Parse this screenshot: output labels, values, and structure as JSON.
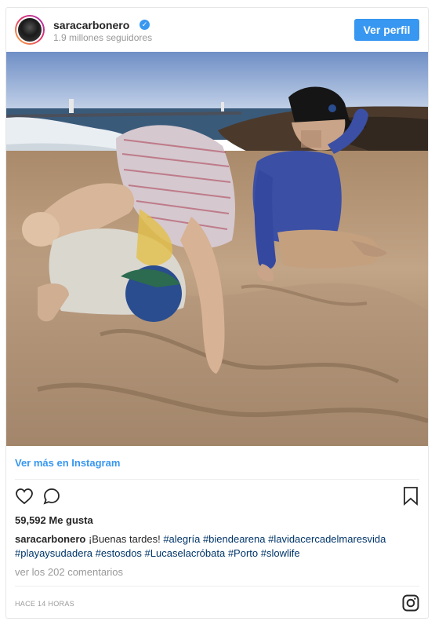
{
  "post": {
    "username": "saracarbonero",
    "followers": "1.9 millones seguidores",
    "follow_button": "Ver perfil",
    "view_more": "Ver más en Instagram",
    "likes": "59,592 Me gusta",
    "caption_user": "saracarbonero",
    "caption_text": " ¡Buenas tardes! ",
    "hashtags": [
      "#alegría",
      "#biendearena",
      "#lavidacercadelmaresvida",
      "#playaysudadera",
      "#estosdos",
      "#Lucaselacróbata",
      "#Porto",
      "#slowlife"
    ],
    "comments_link": "ver los 202 comentarios",
    "timestamp": "HACE 14 HORAS"
  },
  "icons": {
    "verified": "verified-badge-icon",
    "like": "heart-icon",
    "comment": "comment-icon",
    "save": "bookmark-icon",
    "logo": "instagram-logo-icon"
  },
  "colors": {
    "accent": "#3897f0",
    "hashtag": "#003569",
    "muted": "#999999"
  }
}
